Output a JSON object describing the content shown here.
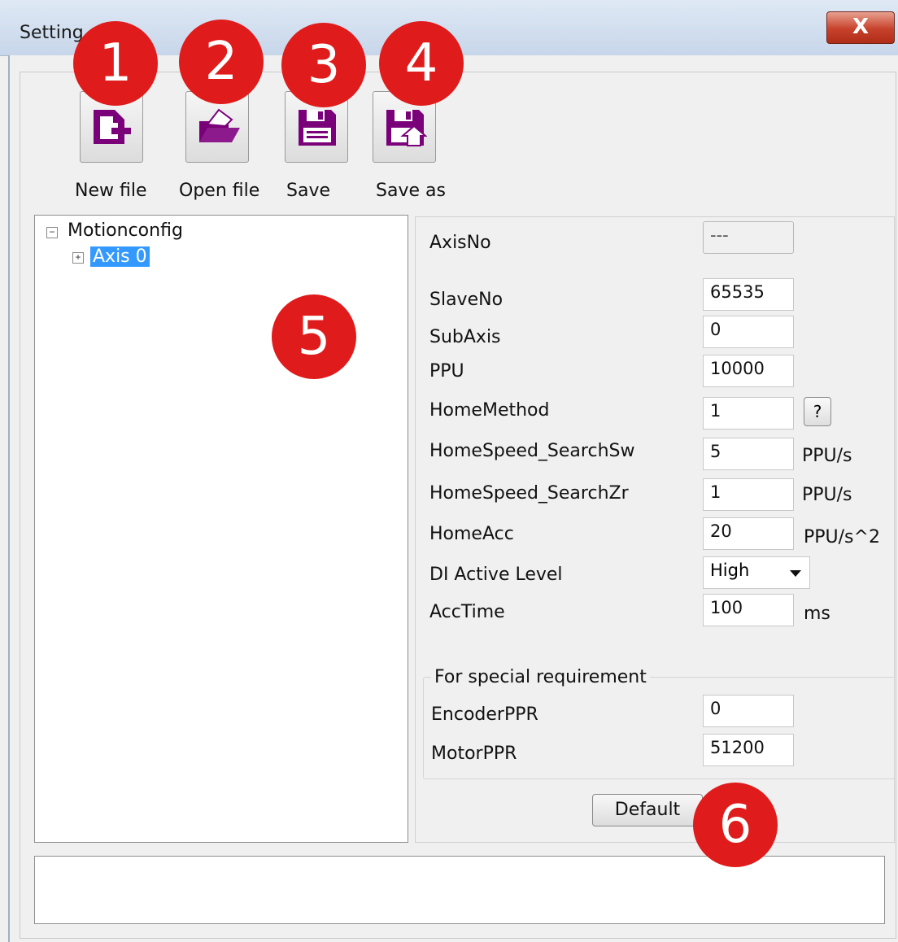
{
  "window": {
    "title": "Setting",
    "close_glyph": "X"
  },
  "toolbar": {
    "buttons": [
      {
        "label": "New file",
        "icon": "new-file-icon"
      },
      {
        "label": "Open file",
        "icon": "open-folder-icon"
      },
      {
        "label": "Save",
        "icon": "save-icon"
      },
      {
        "label": "Save as",
        "icon": "save-as-icon"
      }
    ],
    "icon_color": "#7a007a"
  },
  "callouts": [
    "1",
    "2",
    "3",
    "4",
    "5",
    "6"
  ],
  "tree": {
    "root": {
      "toggle": "−",
      "label": "Motionconfig"
    },
    "child": {
      "toggle": "+",
      "label": "Axis 0"
    }
  },
  "form": {
    "axis_no": {
      "label": "AxisNo",
      "value": "---"
    },
    "slave_no": {
      "label": "SlaveNo",
      "value": "65535"
    },
    "sub_axis": {
      "label": "SubAxis",
      "value": "0"
    },
    "ppu": {
      "label": "PPU",
      "value": "10000"
    },
    "home_method": {
      "label": "HomeMethod",
      "value": "1",
      "help": "?"
    },
    "home_speed_sw": {
      "label": "HomeSpeed_SearchSw",
      "value": "5",
      "unit": "PPU/s"
    },
    "home_speed_zr": {
      "label": "HomeSpeed_SearchZr",
      "value": "1",
      "unit": "PPU/s"
    },
    "home_acc": {
      "label": "HomeAcc",
      "value": "20",
      "unit": "PPU/s^2"
    },
    "di_active": {
      "label": "DI Active Level",
      "value": "High"
    },
    "acc_time": {
      "label": "AccTime",
      "value": "100",
      "unit": "ms"
    },
    "special": {
      "title": "For special requirement",
      "encoder_ppr": {
        "label": "EncoderPPR",
        "value": "0"
      },
      "motor_ppr": {
        "label": "MotorPPR",
        "value": "51200"
      }
    },
    "default_label": "Default"
  },
  "colors": {
    "callout": "#e01b1b",
    "selection": "#3399ff"
  }
}
